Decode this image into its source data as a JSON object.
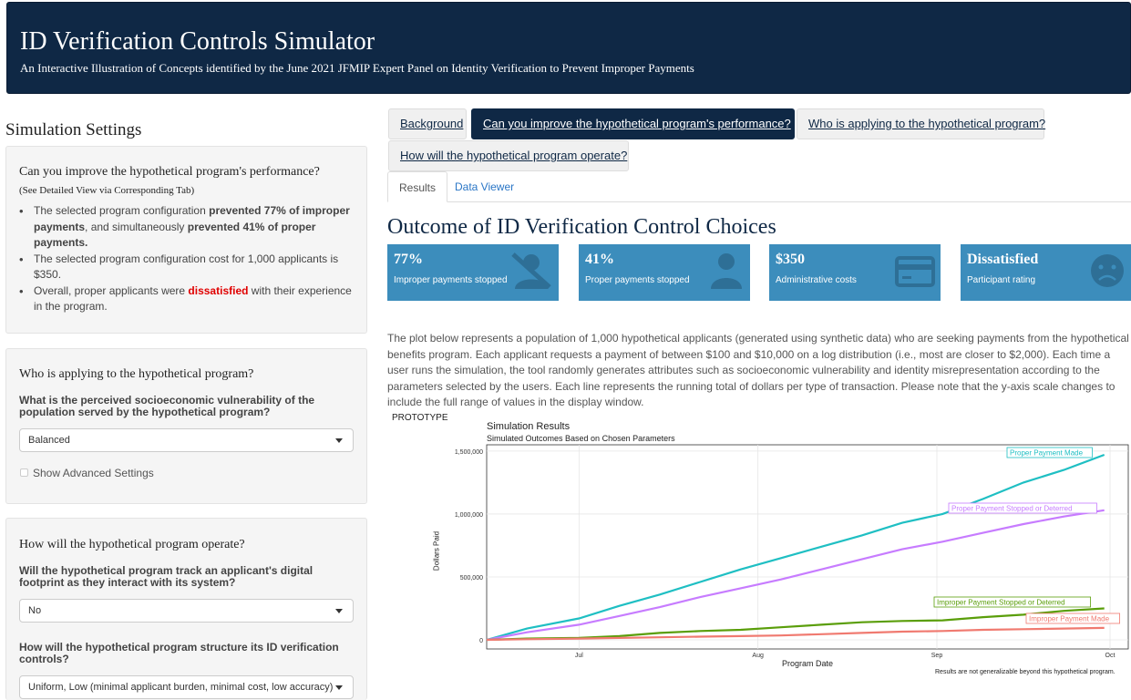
{
  "header": {
    "title": "ID Verification Controls Simulator",
    "subtitle": "An Interactive Illustration of Concepts identified by the June 2021 JFMIP Expert Panel on Identity Verification to Prevent Improper Payments"
  },
  "sidebar": {
    "title": "Simulation Settings",
    "performance": {
      "heading": "Can you improve the hypothetical program's performance?",
      "note": "(See Detailed View via Corresponding Tab)",
      "b1_pre": "The selected program configuration ",
      "b1_bold1": "prevented 77% of improper payments",
      "b1_mid": ", and simultaneously ",
      "b1_bold2": "prevented 41% of proper payments.",
      "b2": "The selected program configuration cost for 1,000 applicants is $350.",
      "b3_pre": "Overall, proper applicants were ",
      "b3_red": "dissatisfied",
      "b3_post": " with their experience in the program."
    },
    "applying": {
      "heading": "Who is applying to the hypothetical program?",
      "question": "What is the perceived socioeconomic vulnerability of the population served by the hypothetical program?",
      "select_value": "Balanced",
      "advanced_label": "Show Advanced Settings"
    },
    "operate": {
      "heading": "How will the hypothetical program operate?",
      "q1": "Will the hypothetical program track an applicant's digital footprint as they interact with its system?",
      "q1_value": "No",
      "q2": "How will the hypothetical program structure its ID verification controls?",
      "q2_value": "Uniform, Low (minimal applicant burden, minimal cost, low accuracy)"
    }
  },
  "tabs": {
    "background": "Background",
    "performance": "Can you improve the hypothetical program's performance?",
    "applying": "Who is applying to the hypothetical program?",
    "operate": "How will the hypothetical program operate?"
  },
  "subtabs": {
    "results": "Results",
    "viewer": "Data Viewer"
  },
  "main": {
    "outcome_title": "Outcome of ID Verification Control Choices",
    "boxes": [
      {
        "value": "77%",
        "label": "Improper payments stopped",
        "icon": "user-slash-icon"
      },
      {
        "value": "41%",
        "label": "Proper payments stopped",
        "icon": "user-icon"
      },
      {
        "value": "$350",
        "label": "Administrative costs",
        "icon": "credit-card-icon"
      },
      {
        "value": "Dissatisfied",
        "label": "Participant rating",
        "icon": "frown-icon"
      }
    ],
    "box_color": "#3c8dbc",
    "description": "The plot below represents a population of 1,000 hypothetical applicants (generated using synthetic data) who are seeking payments from the hypothetical benefits program. Each applicant requests a payment of between $100 and $10,000 on a log distribution (i.e., most are closer to $2,000). Each time a user runs the simulation, the tool randomly generates attributes such as socioeconomic vulnerability and identity misrepresentation according to the parameters selected by the users. Each line represents the running total of dollars per type of transaction. Please note that the y-axis scale changes to include the full range of values in the display window.",
    "prototype": "PROTOTYPE"
  },
  "chart_data": {
    "type": "line",
    "title": "Simulation Results",
    "subtitle": "Simulated Outcomes Based on Chosen Parameters",
    "xlabel": "Program Date",
    "ylabel": "Dollars Paid",
    "x_ticks": [
      "Jul",
      "Aug",
      "Sep",
      "Oct"
    ],
    "y_ticks": [
      "0",
      "500,000",
      "1,000,000",
      "1,500,000"
    ],
    "ylim": [
      0,
      1550000
    ],
    "grid": true,
    "caption": "Results are not generalizable beyond this hypothetical program.",
    "series": [
      {
        "name": "Proper Payment Made",
        "color": "#1fbfc3",
        "x": [
          "06-15",
          "06-22",
          "07-01",
          "07-08",
          "07-15",
          "07-22",
          "07-29",
          "08-05",
          "08-12",
          "08-19",
          "08-26",
          "09-02",
          "09-09",
          "09-16",
          "09-23",
          "09-30"
        ],
        "values": [
          0,
          90000,
          170000,
          270000,
          360000,
          460000,
          560000,
          650000,
          740000,
          830000,
          930000,
          1000000,
          1120000,
          1250000,
          1350000,
          1470000
        ]
      },
      {
        "name": "Proper Payment Stopped or Deterred",
        "color": "#c77cff",
        "x": [
          "06-15",
          "06-22",
          "07-01",
          "07-08",
          "07-15",
          "07-22",
          "07-29",
          "08-05",
          "08-12",
          "08-19",
          "08-26",
          "09-02",
          "09-09",
          "09-16",
          "09-23",
          "09-30"
        ],
        "values": [
          0,
          60000,
          120000,
          190000,
          260000,
          340000,
          410000,
          480000,
          560000,
          640000,
          720000,
          780000,
          850000,
          920000,
          980000,
          1030000
        ]
      },
      {
        "name": "Improper Payment Stopped or Deterred",
        "color": "#5a9e0a",
        "x": [
          "06-15",
          "06-22",
          "07-01",
          "07-08",
          "07-15",
          "07-22",
          "07-29",
          "08-05",
          "08-12",
          "08-19",
          "08-26",
          "09-02",
          "09-09",
          "09-16",
          "09-23",
          "09-30"
        ],
        "values": [
          0,
          10000,
          15000,
          30000,
          55000,
          70000,
          80000,
          100000,
          120000,
          140000,
          150000,
          155000,
          180000,
          200000,
          230000,
          250000
        ]
      },
      {
        "name": "Improper Payment Made",
        "color": "#f07a70",
        "x": [
          "06-15",
          "06-22",
          "07-01",
          "07-08",
          "07-15",
          "07-22",
          "07-29",
          "08-05",
          "08-12",
          "08-19",
          "08-26",
          "09-02",
          "09-09",
          "09-16",
          "09-23",
          "09-30"
        ],
        "values": [
          0,
          5000,
          10000,
          15000,
          20000,
          25000,
          30000,
          35000,
          45000,
          55000,
          65000,
          70000,
          80000,
          85000,
          90000,
          95000
        ]
      }
    ]
  }
}
